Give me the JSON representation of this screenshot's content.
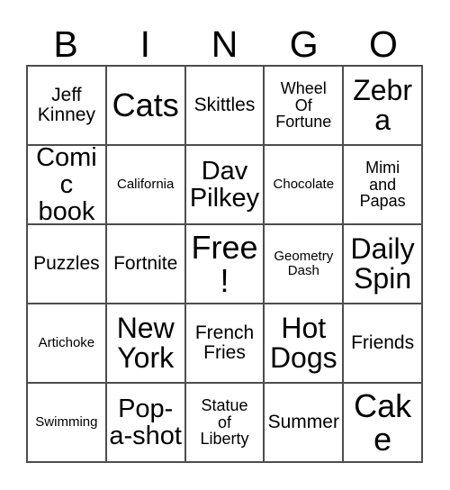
{
  "card": {
    "title_letters": [
      "B",
      "I",
      "N",
      "G",
      "O"
    ],
    "columns": 5,
    "rows": 5,
    "free_space_label": "Free!",
    "border_color": "#4d4d4d",
    "background_color": "#ffffff",
    "text_color": "#000000",
    "cells": [
      {
        "text": "Jeff\nKinney",
        "size": "m"
      },
      {
        "text": "Cats",
        "size": "huge"
      },
      {
        "text": "Skittles",
        "size": "m"
      },
      {
        "text": "Wheel\nOf\nFortune",
        "size": "s"
      },
      {
        "text": "Zebra",
        "size": "xxl"
      },
      {
        "text": "Comic\nbook",
        "size": "xl"
      },
      {
        "text": "California",
        "size": "xs"
      },
      {
        "text": "Dav\nPilkey",
        "size": "xl"
      },
      {
        "text": "Chocolate",
        "size": "xs"
      },
      {
        "text": "Mimi\nand\nPapas",
        "size": "s"
      },
      {
        "text": "Puzzles",
        "size": "m"
      },
      {
        "text": "Fortnite",
        "size": "m"
      },
      {
        "text": "Free!",
        "size": "huge"
      },
      {
        "text": "Geometry\nDash",
        "size": "xs"
      },
      {
        "text": "Daily\nSpin",
        "size": "xxl"
      },
      {
        "text": "Artichoke",
        "size": "xs"
      },
      {
        "text": "New\nYork",
        "size": "xxl"
      },
      {
        "text": "French\nFries",
        "size": "m"
      },
      {
        "text": "Hot\nDogs",
        "size": "xxl"
      },
      {
        "text": "Friends",
        "size": "m"
      },
      {
        "text": "Swimming",
        "size": "xs"
      },
      {
        "text": "Pop-\na-shot",
        "size": "xl"
      },
      {
        "text": "Statue\nof\nLiberty",
        "size": "s"
      },
      {
        "text": "Summer",
        "size": "m"
      },
      {
        "text": "Cake",
        "size": "huge"
      }
    ]
  }
}
